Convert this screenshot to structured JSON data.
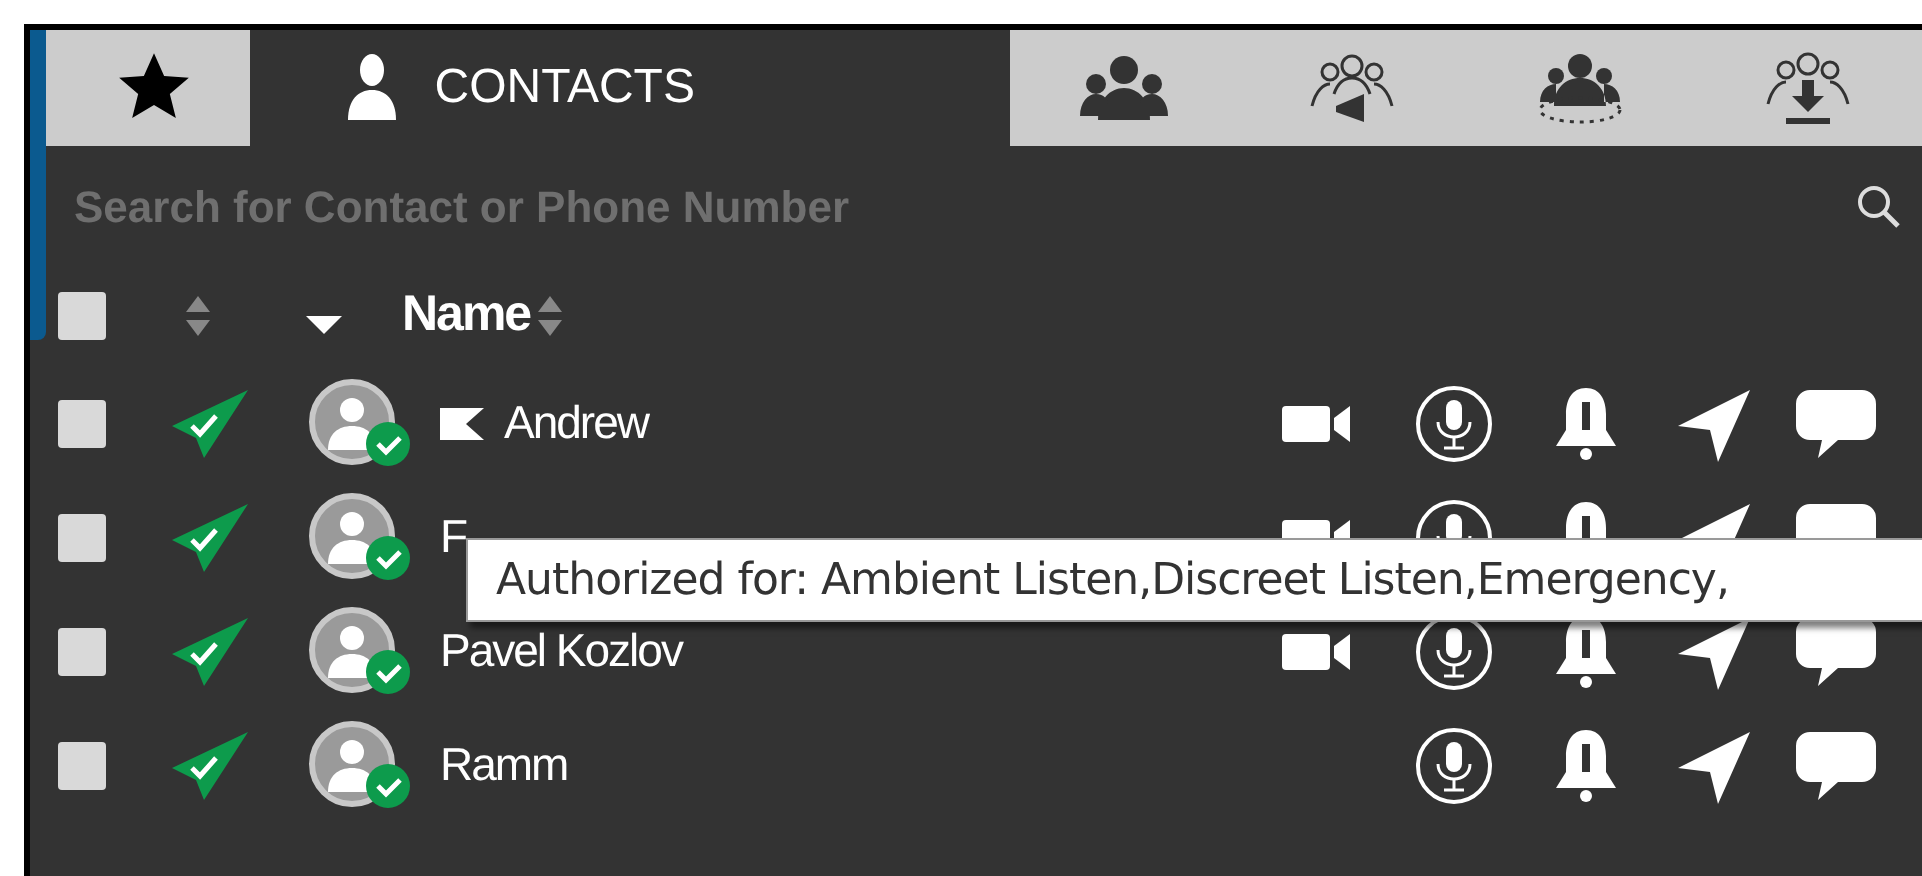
{
  "tabs": [
    {
      "kind": "favorites",
      "selected": false
    },
    {
      "kind": "contacts",
      "label": "CONTACTS",
      "selected": true
    },
    {
      "kind": "groups",
      "selected": false
    },
    {
      "kind": "broadcast",
      "selected": false
    },
    {
      "kind": "scan",
      "selected": false
    },
    {
      "kind": "import",
      "selected": false
    }
  ],
  "search": {
    "placeholder": "Search for Contact or Phone Number"
  },
  "header": {
    "select_all": {
      "checked": false
    },
    "name_column": "Name"
  },
  "rows": [
    {
      "name": "Andrew",
      "checked": false,
      "flagged": true,
      "video": true
    },
    {
      "name": "F",
      "checked": false,
      "flagged": false,
      "video": true
    },
    {
      "name": "Pavel Kozlov",
      "checked": false,
      "flagged": false,
      "video": true
    },
    {
      "name": "Ramm",
      "checked": false,
      "flagged": false,
      "video": false
    }
  ],
  "tooltip": {
    "text": "Authorized for: Ambient Listen,Discreet Listen,Emergency,"
  }
}
